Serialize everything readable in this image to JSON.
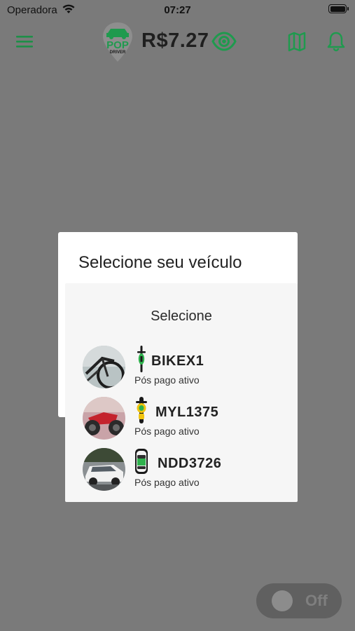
{
  "status_bar": {
    "carrier": "Operadora",
    "time": "07:27"
  },
  "header": {
    "logo_top": "POP",
    "logo_bottom": "DRIVER",
    "balance": "R$7.27"
  },
  "background_dialog": {
    "title": "Selecione seu veículo"
  },
  "modal": {
    "title": "Selecione",
    "vehicles": [
      {
        "plate": "BIKEX1",
        "status": "Pós pago ativo",
        "type_icon": "bicycle-icon"
      },
      {
        "plate": "MYL1375",
        "status": "Pós pago ativo",
        "type_icon": "motorcycle-icon"
      },
      {
        "plate": "NDD3726",
        "status": "Pós pago ativo",
        "type_icon": "car-icon"
      }
    ]
  },
  "toggle": {
    "label": "Off",
    "state": "off"
  },
  "colors": {
    "brand_green": "#1f9a4e",
    "overlay": "#7a7a7a"
  }
}
